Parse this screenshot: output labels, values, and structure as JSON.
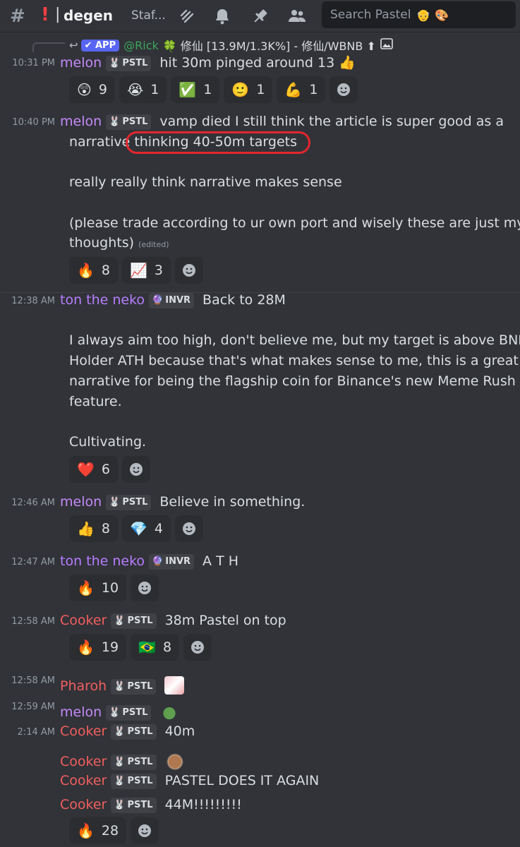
{
  "header": {
    "hash_icon": "#",
    "alert_icon": "!",
    "separator": "|",
    "channel_name": "degen",
    "staff_label": "Staf...",
    "search_placeholder": "Search Pastel",
    "search_emojis": [
      "👴",
      "🎨"
    ]
  },
  "reply": {
    "app_label": "APP",
    "user": "@Rick",
    "text": "🍀 修仙 [13.9M/1.3K%] - 修仙/WBNB ⬆"
  },
  "messages": [
    {
      "time": "10:31 PM",
      "author": "melon",
      "tag": "PSTL",
      "text": "hit 30m pinged around 13 👍",
      "reactions": [
        [
          "😲",
          "9"
        ],
        [
          "😭",
          "1"
        ],
        [
          "✅",
          "1"
        ],
        [
          "🙂",
          "1"
        ],
        [
          "💪",
          "1"
        ]
      ]
    },
    {
      "time": "10:40 PM",
      "author": "melon",
      "tag": "PSTL",
      "text": "vamp died I still think the article is super good as a",
      "lines": [
        "narrative thinking 40-50m targets",
        "really really think narrative makes sense",
        "(please trade according to ur own port and wisely these are just my",
        "thoughts)"
      ],
      "edited": "(edited)",
      "reactions": [
        [
          "🔥",
          "8"
        ],
        [
          "📈",
          "3"
        ]
      ]
    },
    {
      "time": "12:38 AM",
      "author": "ton the neko",
      "tag": "INVR",
      "text": "Back to 28M",
      "lines": [
        "I always aim too high, don't believe me, but my target is above BNB",
        "Holder ATH because that's what makes sense to me, this is a great",
        "narrative for being the flagship coin for Binance's new Meme Rush",
        "feature.",
        "Cultivating."
      ],
      "reactions": [
        [
          "❤️",
          "6"
        ]
      ]
    },
    {
      "time": "12:46 AM",
      "author": "melon",
      "tag": "PSTL",
      "text": "Believe in something.",
      "reactions": [
        [
          "👍",
          "8"
        ],
        [
          "💎",
          "4"
        ]
      ]
    },
    {
      "time": "12:47 AM",
      "author": "ton the neko",
      "tag": "INVR",
      "text": "A T H",
      "reactions": [
        [
          "🔥",
          "10"
        ]
      ]
    },
    {
      "time": "12:58 AM",
      "author": "Cooker",
      "tag": "PSTL",
      "text": "38m Pastel on top",
      "reactions": [
        [
          "🔥",
          "19"
        ],
        [
          "🇧🇷",
          "8"
        ]
      ]
    },
    {
      "time": "12:58 AM",
      "author": "Pharoh",
      "tag": "PSTL",
      "text": ""
    },
    {
      "time": "12:59 AM",
      "author": "melon",
      "tag": "PSTL",
      "text": ""
    },
    {
      "time": "2:14 AM",
      "author": "Cooker",
      "tag": "PSTL",
      "text": "40m"
    },
    {
      "time": "",
      "author": "Cooker",
      "tag": "PSTL",
      "text": ""
    },
    {
      "time": "",
      "author": "Cooker",
      "tag": "PSTL",
      "text": "PASTEL DOES IT AGAIN"
    },
    {
      "time": "",
      "author": "Cooker",
      "tag": "PSTL",
      "text": "44M!!!!!!!!!",
      "reactions": [
        [
          "🔥",
          "28"
        ]
      ]
    }
  ],
  "colors": {
    "background": "#313338",
    "melon": "#c58af9",
    "ton_the_neko": "#b77dff",
    "cooker": "#f25e5e",
    "highlight_ring": "#e3262e"
  },
  "icons": [
    "threads-icon",
    "bell-icon",
    "pin-icon",
    "members-icon",
    "add-reaction-icon",
    "reply-arrow-icon",
    "image-icon"
  ]
}
